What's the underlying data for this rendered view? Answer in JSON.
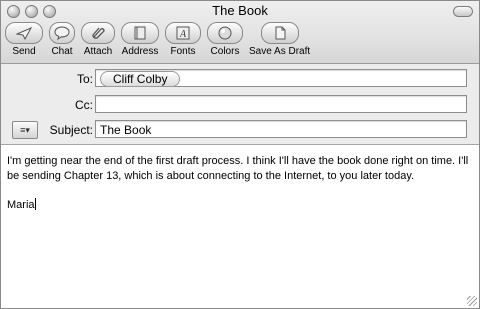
{
  "window": {
    "title": "The Book"
  },
  "toolbar": {
    "items": [
      {
        "label": "Send",
        "icon": "send-icon"
      },
      {
        "label": "Chat",
        "icon": "chat-icon"
      },
      {
        "label": "Attach",
        "icon": "paperclip-icon"
      },
      {
        "label": "Address",
        "icon": "address-book-icon"
      },
      {
        "label": "Fonts",
        "icon": "fonts-icon"
      },
      {
        "label": "Colors",
        "icon": "colors-icon"
      },
      {
        "label": "Save As Draft",
        "icon": "save-draft-icon"
      }
    ]
  },
  "headers": {
    "to_label": "To:",
    "to_recipient": "Cliff Colby",
    "cc_label": "Cc:",
    "cc_value": "",
    "subject_label": "Subject:",
    "subject_value": "The Book"
  },
  "message": {
    "paragraph_1": "I'm getting near the end of the first draft process. I think I'll have the book done right on time. I'll be sending Chapter 13, which is about connecting to the Internet, to you later today.",
    "signature": "Maria"
  }
}
